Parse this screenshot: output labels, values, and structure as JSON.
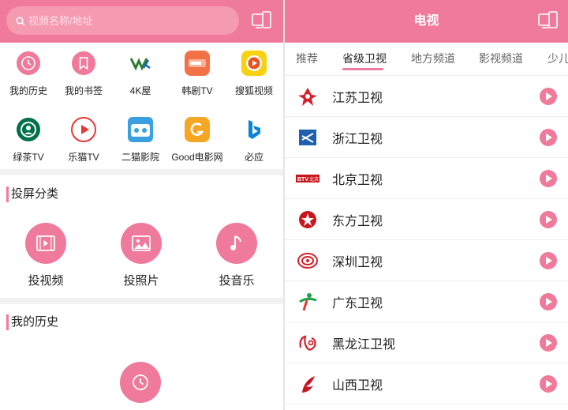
{
  "colors": {
    "accent": "#f07a9b",
    "accent_light": "#f49bb2",
    "text": "#222222",
    "muted": "#666666"
  },
  "left": {
    "search": {
      "placeholder": "视频名称/地址",
      "icon": "search-icon"
    },
    "cast_icon": "cast-screen-icon",
    "apps": [
      {
        "label": "我的历史",
        "icon": "history-icon"
      },
      {
        "label": "我的书签",
        "icon": "bookmark-icon"
      },
      {
        "label": "4K屋",
        "icon": "4k-logo-icon"
      },
      {
        "label": "韩剧TV",
        "icon": "hanju-tv-logo-icon"
      },
      {
        "label": "搜狐视频",
        "icon": "sohu-video-logo-icon"
      },
      {
        "label": "绿茶TV",
        "icon": "starbucks-logo-icon"
      },
      {
        "label": "乐猫TV",
        "icon": "play-circle-logo-icon"
      },
      {
        "label": "二猫影院",
        "icon": "ermao-logo-icon"
      },
      {
        "label": "Good电影网",
        "icon": "good-g-logo-icon"
      },
      {
        "label": "必应",
        "icon": "bing-logo-icon"
      }
    ],
    "cast_section": {
      "title": "投屏分类",
      "items": [
        {
          "label": "投视频",
          "icon": "video-icon"
        },
        {
          "label": "投照片",
          "icon": "photo-icon"
        },
        {
          "label": "投音乐",
          "icon": "music-icon"
        }
      ]
    },
    "history_section": {
      "title": "我的历史",
      "icon": "history-icon"
    }
  },
  "right": {
    "title": "电视",
    "cast_icon": "cast-screen-icon",
    "tabs": [
      "推荐",
      "省级卫视",
      "地方频道",
      "影视频道",
      "少儿"
    ],
    "active_tab": "省级卫视",
    "channels": [
      {
        "name": "江苏卫视",
        "logo": "jiangsu-tv-logo-icon",
        "logo_color": "#d4202a"
      },
      {
        "name": "浙江卫视",
        "logo": "zhejiang-tv-logo-icon",
        "logo_color": "#1f5fb0"
      },
      {
        "name": "北京卫视",
        "logo": "btv-logo-icon",
        "logo_color": "#c8161d",
        "logo_text": "BTV 北京"
      },
      {
        "name": "东方卫视",
        "logo": "dragon-tv-logo-icon",
        "logo_color": "#c8161d"
      },
      {
        "name": "深圳卫视",
        "logo": "shenzhen-tv-logo-icon",
        "logo_color": "#d4202a"
      },
      {
        "name": "广东卫视",
        "logo": "guangdong-tv-logo-icon",
        "logo_color": "#1aa34a"
      },
      {
        "name": "黑龙江卫视",
        "logo": "heilongjiang-tv-logo-icon",
        "logo_color": "#d4202a"
      },
      {
        "name": "山西卫视",
        "logo": "shanxi-tv-logo-icon",
        "logo_color": "#c8161d"
      }
    ],
    "play_icon": "play-icon"
  }
}
